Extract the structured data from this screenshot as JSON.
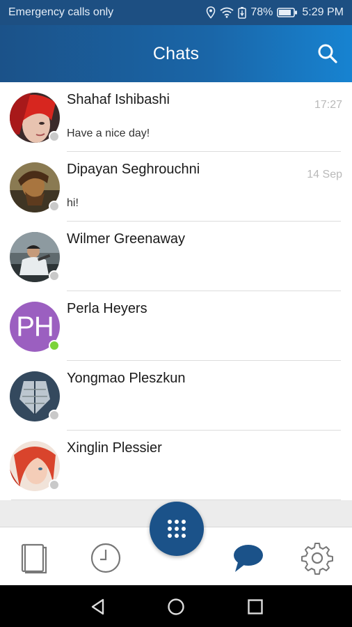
{
  "status_bar": {
    "carrier": "Emergency calls only",
    "battery": "78%",
    "time": "5:29 PM"
  },
  "header": {
    "title": "Chats",
    "search_icon": "search-icon"
  },
  "chats": [
    {
      "name": "Shahaf Ishibashi",
      "time": "17:27",
      "message": "Have a nice day!",
      "status": "offline",
      "avatar": "photo"
    },
    {
      "name": "Dipayan Seghrouchni",
      "time": "14 Sep",
      "message": "hi!",
      "status": "offline",
      "avatar": "photo"
    },
    {
      "name": "Wilmer Greenaway",
      "time": "",
      "message": "",
      "status": "offline",
      "avatar": "photo"
    },
    {
      "name": "Perla Heyers",
      "time": "",
      "message": "",
      "status": "online",
      "avatar": "initials",
      "initials": "PH"
    },
    {
      "name": "Yongmao Pleszkun",
      "time": "",
      "message": "",
      "status": "offline",
      "avatar": "photo"
    },
    {
      "name": "Xinglin Plessier",
      "time": "",
      "message": "",
      "status": "offline",
      "avatar": "photo"
    }
  ],
  "bottom_nav": {
    "items": [
      "contacts-book-icon",
      "recents-clock-icon",
      "dialpad-icon",
      "chat-bubble-icon",
      "settings-gear-icon"
    ],
    "active": "chat-bubble-icon"
  },
  "colors": {
    "brand": "#1b5289",
    "online": "#7cd33a",
    "offline": "#c9c9c9",
    "initials_bg": "#9b5fc0"
  }
}
